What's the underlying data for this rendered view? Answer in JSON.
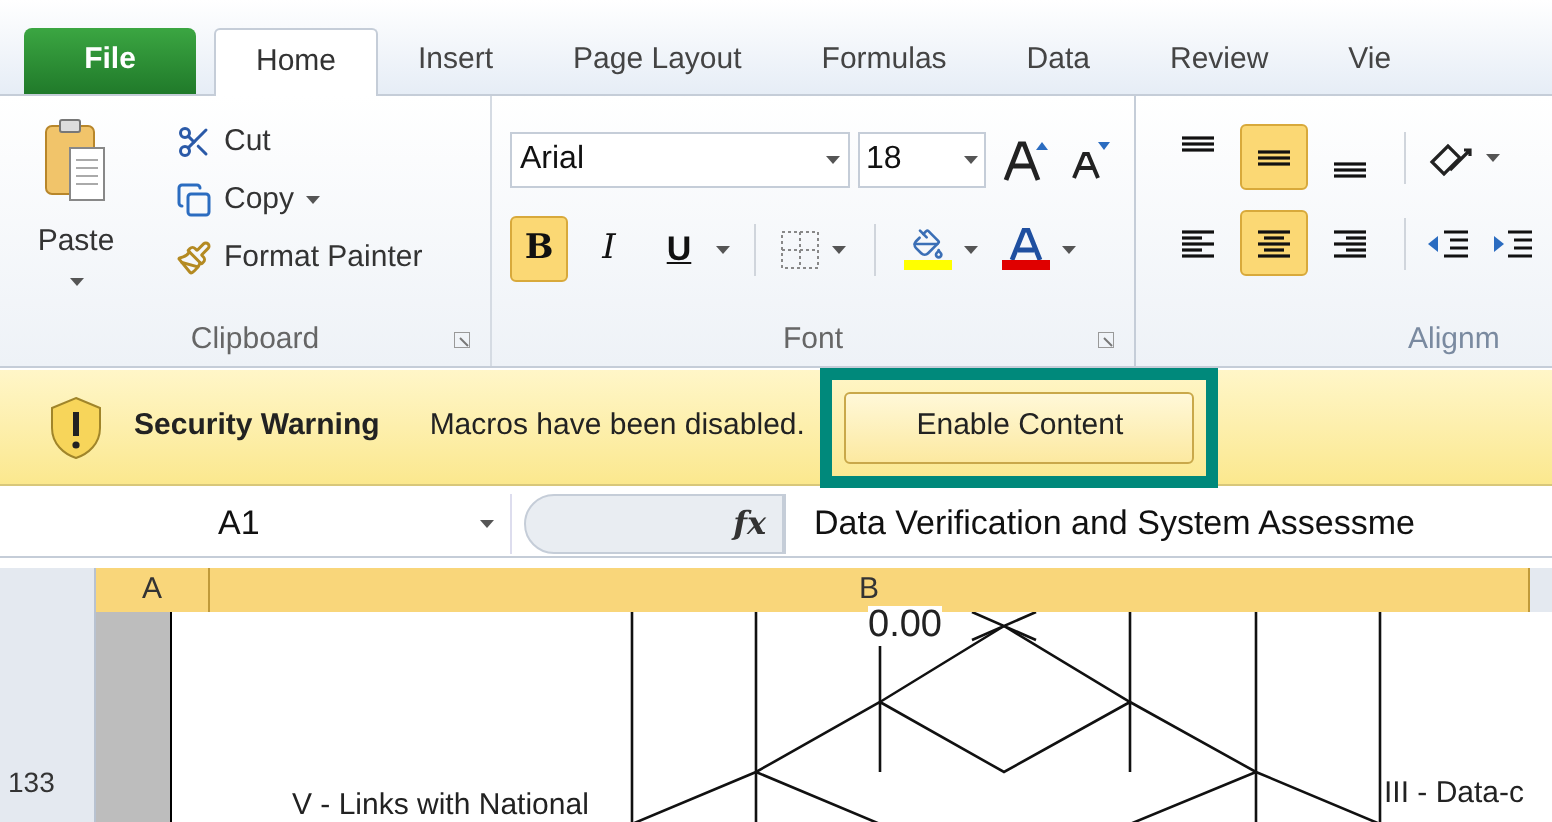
{
  "tabs": [
    {
      "label": "File",
      "kind": "file",
      "selected": false
    },
    {
      "label": "Home",
      "kind": "tab",
      "selected": true
    },
    {
      "label": "Insert",
      "kind": "tab",
      "selected": false
    },
    {
      "label": "Page Layout",
      "kind": "tab",
      "selected": false
    },
    {
      "label": "Formulas",
      "kind": "tab",
      "selected": false
    },
    {
      "label": "Data",
      "kind": "tab",
      "selected": false
    },
    {
      "label": "Review",
      "kind": "tab",
      "selected": false
    },
    {
      "label": "Vie",
      "kind": "tab",
      "selected": false
    }
  ],
  "clipboard": {
    "paste": "Paste",
    "cut": "Cut",
    "copy": "Copy",
    "format_painter": "Format Painter",
    "label": "Clipboard"
  },
  "font": {
    "name": "Arial",
    "size": "18",
    "label": "Font",
    "styles": [
      {
        "label": "B",
        "kind": "bold",
        "selected": true
      },
      {
        "label": "I",
        "kind": "italic",
        "selected": false
      },
      {
        "label": "U",
        "kind": "underline",
        "selected": false
      }
    ]
  },
  "alignment": {
    "label": "Alignm",
    "vertical": [
      {
        "kind": "top",
        "selected": false
      },
      {
        "kind": "middle",
        "selected": true
      },
      {
        "kind": "bottom",
        "selected": false
      }
    ],
    "horizontal": [
      {
        "kind": "left",
        "selected": false
      },
      {
        "kind": "center",
        "selected": true
      },
      {
        "kind": "right",
        "selected": false
      }
    ]
  },
  "security_bar": {
    "title": "Security Warning",
    "message": "Macros have been disabled.",
    "button": "Enable Content",
    "highlighted": true
  },
  "formula_bar": {
    "name_box": "A1",
    "fx": "fx",
    "formula": "Data Verification and System Assessme"
  },
  "sheet": {
    "columns": [
      "A",
      "B"
    ],
    "row": "133",
    "labels": [
      "0.00",
      "V - Links with National",
      "III - Data-c"
    ]
  }
}
